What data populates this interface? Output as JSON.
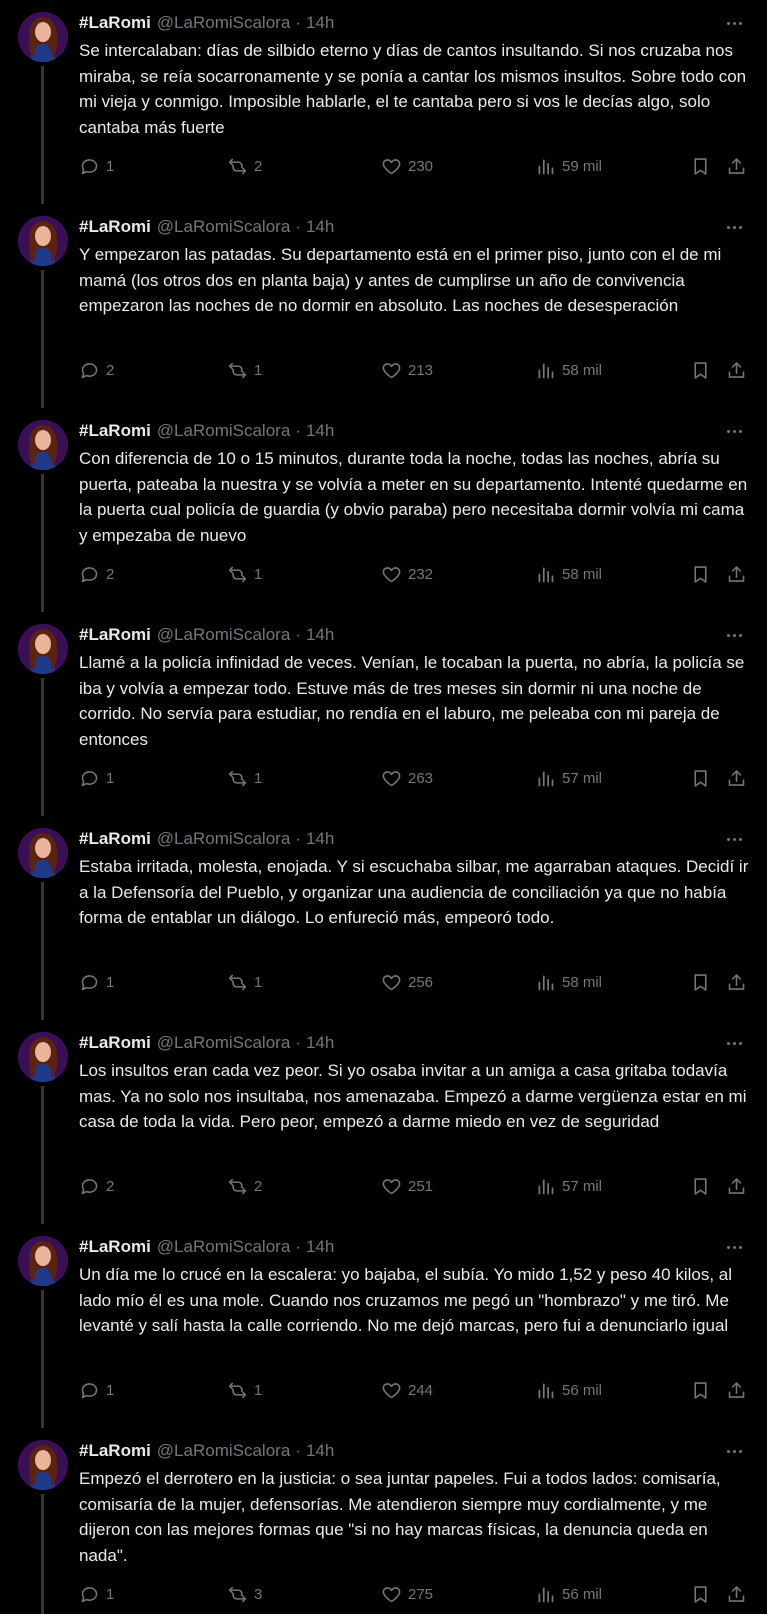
{
  "author": {
    "display_name": "#LaRomi",
    "handle": "@LaRomiScalora",
    "separator": "·",
    "time": "14h"
  },
  "tweets": [
    {
      "text": "Se intercalaban: días de silbido eterno y días de cantos insultando. Si nos cruzaba nos miraba, se reía socarronamente y se ponía a cantar los mismos insultos. Sobre todo con mi vieja y conmigo. Imposible hablarle, el te cantaba pero si vos le decías algo, solo cantaba más fuerte",
      "replies": "1",
      "retweets": "2",
      "likes": "230",
      "views": "59 mil"
    },
    {
      "text": "Y empezaron las patadas. Su departamento está en el primer piso, junto con el de mi mamá (los otros dos en planta baja) y antes de cumplirse un año de convivencia empezaron las noches de no dormir en absoluto. Las noches de desesperación",
      "replies": "2",
      "retweets": "1",
      "likes": "213",
      "views": "58 mil"
    },
    {
      "text": "Con diferencia de 10 o 15 minutos, durante toda la noche, todas las noches, abría su puerta, pateaba la nuestra y se volvía a meter en su departamento. Intenté quedarme en la puerta cual policía de guardia (y obvio paraba) pero necesitaba dormir volvía mi cama y empezaba de nuevo",
      "replies": "2",
      "retweets": "1",
      "likes": "232",
      "views": "58 mil"
    },
    {
      "text": "Llamé a la policía infinidad de veces. Venían, le tocaban la puerta, no abría, la policía se iba y volvía a empezar todo. Estuve más de tres meses sin dormir ni una noche de corrido. No servía para estudiar, no rendía en el laburo, me peleaba con mi pareja de entonces",
      "replies": "1",
      "retweets": "1",
      "likes": "263",
      "views": "57 mil"
    },
    {
      "text": "Estaba irritada, molesta, enojada. Y si escuchaba silbar, me agarraban ataques. Decidí ir a la Defensoría del Pueblo, y organizar una audiencia de conciliación ya que no había forma de entablar un diálogo. Lo enfureció más, empeoró todo.",
      "replies": "1",
      "retweets": "1",
      "likes": "256",
      "views": "58 mil"
    },
    {
      "text": "Los insultos eran cada vez peor. Si yo osaba invitar a un amiga a casa gritaba todavía mas. Ya no solo nos insultaba, nos amenazaba. Empezó a darme vergüenza estar en mi casa de toda la vida. Pero peor, empezó a darme miedo en vez de seguridad",
      "replies": "2",
      "retweets": "2",
      "likes": "251",
      "views": "57 mil"
    },
    {
      "text": "Un día me lo crucé en la escalera: yo bajaba, el subía. Yo mido 1,52 y peso 40 kilos, al lado mío él es una mole. Cuando nos cruzamos me pegó un \"hombrazo\" y me tiró. Me levanté y salí hasta la calle corriendo. No me dejó marcas, pero fui a denunciarlo igual",
      "replies": "1",
      "retweets": "1",
      "likes": "244",
      "views": "56 mil"
    },
    {
      "text": "Empezó el derrotero en la justicia: o sea juntar papeles. Fui a todos lados: comisaría, comisaría de la mujer, defensorías. Me atendieron siempre muy cordialmente, y me dijeron con las mejores formas que \"si no hay marcas físicas, la denuncia queda en nada\".",
      "replies": "1",
      "retweets": "3",
      "likes": "275",
      "views": "56 mil"
    }
  ],
  "colors": {
    "background": "#000000",
    "text": "#e7e9ea",
    "secondary": "#71767b",
    "thread_line": "#333639"
  },
  "icons": {
    "reply": "speech-bubble-icon",
    "retweet": "retweet-arrows-icon",
    "like": "heart-icon",
    "views": "bar-chart-icon",
    "bookmark": "bookmark-icon",
    "share": "share-upload-icon",
    "more": "more-dots-icon"
  }
}
